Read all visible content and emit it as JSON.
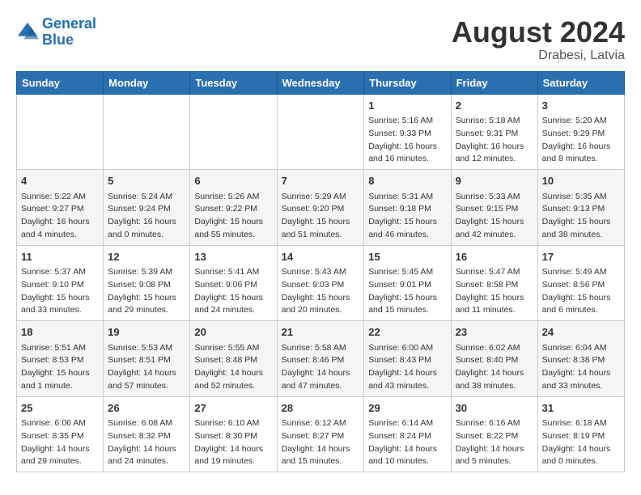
{
  "header": {
    "logo_line1": "General",
    "logo_line2": "Blue",
    "month_year": "August 2024",
    "location": "Drabesi, Latvia"
  },
  "weekdays": [
    "Sunday",
    "Monday",
    "Tuesday",
    "Wednesday",
    "Thursday",
    "Friday",
    "Saturday"
  ],
  "weeks": [
    [
      {
        "day": "",
        "content": ""
      },
      {
        "day": "",
        "content": ""
      },
      {
        "day": "",
        "content": ""
      },
      {
        "day": "",
        "content": ""
      },
      {
        "day": "1",
        "content": "Sunrise: 5:16 AM\nSunset: 9:33 PM\nDaylight: 16 hours\nand 16 minutes."
      },
      {
        "day": "2",
        "content": "Sunrise: 5:18 AM\nSunset: 9:31 PM\nDaylight: 16 hours\nand 12 minutes."
      },
      {
        "day": "3",
        "content": "Sunrise: 5:20 AM\nSunset: 9:29 PM\nDaylight: 16 hours\nand 8 minutes."
      }
    ],
    [
      {
        "day": "4",
        "content": "Sunrise: 5:22 AM\nSunset: 9:27 PM\nDaylight: 16 hours\nand 4 minutes."
      },
      {
        "day": "5",
        "content": "Sunrise: 5:24 AM\nSunset: 9:24 PM\nDaylight: 16 hours\nand 0 minutes."
      },
      {
        "day": "6",
        "content": "Sunrise: 5:26 AM\nSunset: 9:22 PM\nDaylight: 15 hours\nand 55 minutes."
      },
      {
        "day": "7",
        "content": "Sunrise: 5:29 AM\nSunset: 9:20 PM\nDaylight: 15 hours\nand 51 minutes."
      },
      {
        "day": "8",
        "content": "Sunrise: 5:31 AM\nSunset: 9:18 PM\nDaylight: 15 hours\nand 46 minutes."
      },
      {
        "day": "9",
        "content": "Sunrise: 5:33 AM\nSunset: 9:15 PM\nDaylight: 15 hours\nand 42 minutes."
      },
      {
        "day": "10",
        "content": "Sunrise: 5:35 AM\nSunset: 9:13 PM\nDaylight: 15 hours\nand 38 minutes."
      }
    ],
    [
      {
        "day": "11",
        "content": "Sunrise: 5:37 AM\nSunset: 9:10 PM\nDaylight: 15 hours\nand 33 minutes."
      },
      {
        "day": "12",
        "content": "Sunrise: 5:39 AM\nSunset: 9:08 PM\nDaylight: 15 hours\nand 29 minutes."
      },
      {
        "day": "13",
        "content": "Sunrise: 5:41 AM\nSunset: 9:06 PM\nDaylight: 15 hours\nand 24 minutes."
      },
      {
        "day": "14",
        "content": "Sunrise: 5:43 AM\nSunset: 9:03 PM\nDaylight: 15 hours\nand 20 minutes."
      },
      {
        "day": "15",
        "content": "Sunrise: 5:45 AM\nSunset: 9:01 PM\nDaylight: 15 hours\nand 15 minutes."
      },
      {
        "day": "16",
        "content": "Sunrise: 5:47 AM\nSunset: 8:58 PM\nDaylight: 15 hours\nand 11 minutes."
      },
      {
        "day": "17",
        "content": "Sunrise: 5:49 AM\nSunset: 8:56 PM\nDaylight: 15 hours\nand 6 minutes."
      }
    ],
    [
      {
        "day": "18",
        "content": "Sunrise: 5:51 AM\nSunset: 8:53 PM\nDaylight: 15 hours\nand 1 minute."
      },
      {
        "day": "19",
        "content": "Sunrise: 5:53 AM\nSunset: 8:51 PM\nDaylight: 14 hours\nand 57 minutes."
      },
      {
        "day": "20",
        "content": "Sunrise: 5:55 AM\nSunset: 8:48 PM\nDaylight: 14 hours\nand 52 minutes."
      },
      {
        "day": "21",
        "content": "Sunrise: 5:58 AM\nSunset: 8:46 PM\nDaylight: 14 hours\nand 47 minutes."
      },
      {
        "day": "22",
        "content": "Sunrise: 6:00 AM\nSunset: 8:43 PM\nDaylight: 14 hours\nand 43 minutes."
      },
      {
        "day": "23",
        "content": "Sunrise: 6:02 AM\nSunset: 8:40 PM\nDaylight: 14 hours\nand 38 minutes."
      },
      {
        "day": "24",
        "content": "Sunrise: 6:04 AM\nSunset: 8:38 PM\nDaylight: 14 hours\nand 33 minutes."
      }
    ],
    [
      {
        "day": "25",
        "content": "Sunrise: 6:06 AM\nSunset: 8:35 PM\nDaylight: 14 hours\nand 29 minutes."
      },
      {
        "day": "26",
        "content": "Sunrise: 6:08 AM\nSunset: 8:32 PM\nDaylight: 14 hours\nand 24 minutes."
      },
      {
        "day": "27",
        "content": "Sunrise: 6:10 AM\nSunset: 8:30 PM\nDaylight: 14 hours\nand 19 minutes."
      },
      {
        "day": "28",
        "content": "Sunrise: 6:12 AM\nSunset: 8:27 PM\nDaylight: 14 hours\nand 15 minutes."
      },
      {
        "day": "29",
        "content": "Sunrise: 6:14 AM\nSunset: 8:24 PM\nDaylight: 14 hours\nand 10 minutes."
      },
      {
        "day": "30",
        "content": "Sunrise: 6:16 AM\nSunset: 8:22 PM\nDaylight: 14 hours\nand 5 minutes."
      },
      {
        "day": "31",
        "content": "Sunrise: 6:18 AM\nSunset: 8:19 PM\nDaylight: 14 hours\nand 0 minutes."
      }
    ]
  ]
}
